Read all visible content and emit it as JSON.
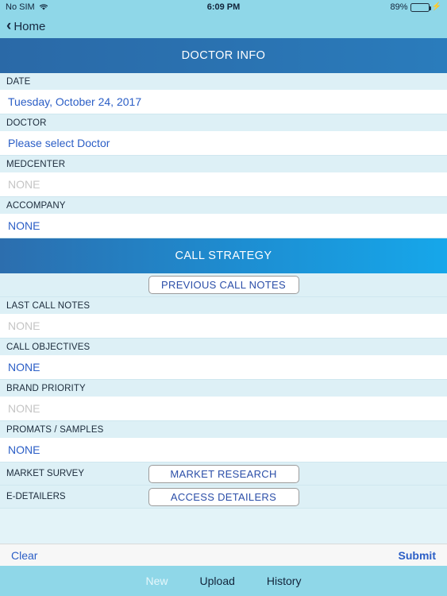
{
  "statusbar": {
    "carrier": "No SIM",
    "wifi_icon": "wifi-icon",
    "time": "6:09 PM",
    "battery_percent": "89%",
    "battery_icon": "battery-icon",
    "charging_icon": "charging-bolt-icon"
  },
  "navbar": {
    "back_icon": "chevron-left-icon",
    "back_label": "Home"
  },
  "sections": {
    "doctor_info": {
      "title": "DOCTOR INFO",
      "fields": [
        {
          "label": "DATE",
          "value": "Tuesday, October 24, 2017",
          "is_placeholder": false
        },
        {
          "label": "DOCTOR",
          "value": "Please select Doctor",
          "is_placeholder": false
        },
        {
          "label": "MEDCENTER",
          "value": "NONE",
          "is_placeholder": true
        },
        {
          "label": "ACCOMPANY",
          "value": "NONE",
          "is_placeholder": false
        }
      ]
    },
    "call_strategy": {
      "title": "CALL STRATEGY",
      "previous_call_notes_button": "PREVIOUS CALL NOTES",
      "fields": [
        {
          "label": "LAST CALL NOTES",
          "value": "NONE",
          "is_placeholder": true
        },
        {
          "label": "CALL OBJECTIVES",
          "value": "NONE",
          "is_placeholder": false
        },
        {
          "label": "BRAND PRIORITY",
          "value": "NONE",
          "is_placeholder": true
        },
        {
          "label": "PROMATS / SAMPLES",
          "value": "NONE",
          "is_placeholder": false
        }
      ],
      "button_rows": [
        {
          "label": "MARKET SURVEY",
          "button": "MARKET RESEARCH"
        },
        {
          "label": "E-DETAILERS",
          "button": "ACCESS DETAILERS"
        }
      ]
    }
  },
  "toolbar": {
    "clear_label": "Clear",
    "submit_label": "Submit"
  },
  "tabbar": {
    "tabs": [
      {
        "label": "New",
        "active": false
      },
      {
        "label": "Upload",
        "active": true
      },
      {
        "label": "History",
        "active": true
      }
    ]
  },
  "colors": {
    "accent_blue": "#2b5ec6",
    "header_blue": "#2a69a7",
    "header_cyan": "#16a7ea",
    "bar_teal": "#8fd7e8",
    "field_bg": "#ddf0f6",
    "placeholder_gray": "#c5c5c5"
  }
}
